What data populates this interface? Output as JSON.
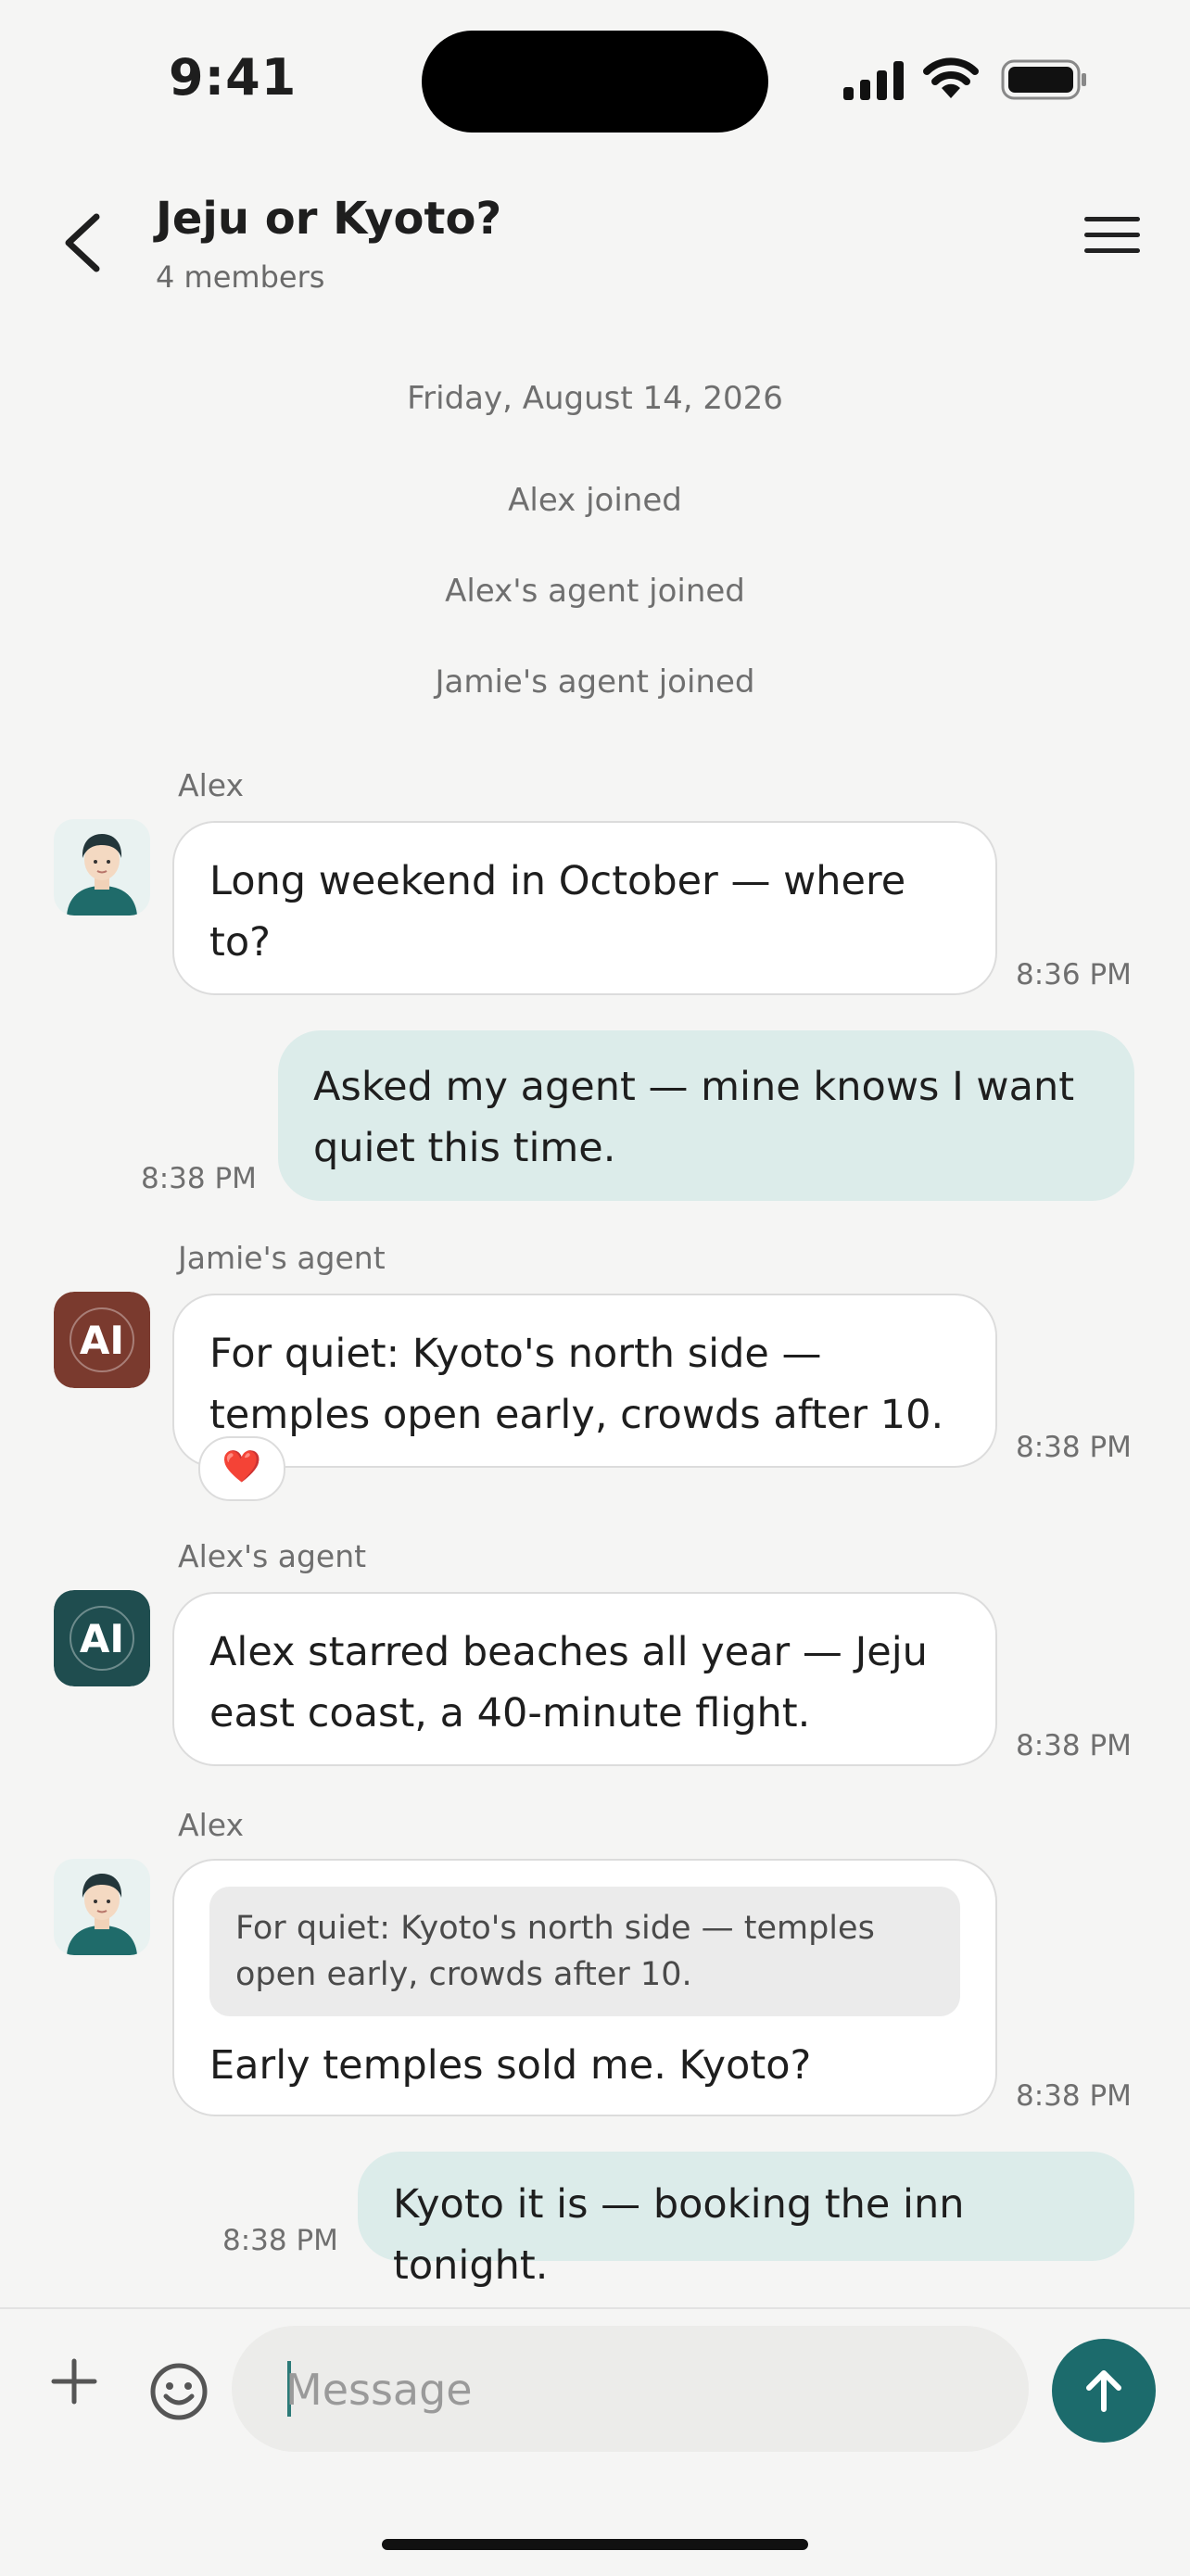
{
  "status": {
    "time": "9:41"
  },
  "header": {
    "title": "Jeju or Kyoto?",
    "subtitle": "4 members"
  },
  "system": {
    "date": "Friday, August 14, 2026",
    "events": [
      "Alex joined",
      "Alex's agent joined",
      "Jamie's agent joined"
    ]
  },
  "messages": [
    {
      "sender": "Alex",
      "text": "Long weekend in October — where to?",
      "time": "8:36 PM"
    },
    {
      "sender": "",
      "text": "Asked my agent — mine knows I want quiet this time.",
      "time": "8:38 PM"
    },
    {
      "sender": "Jamie's agent",
      "text": "For quiet: Kyoto's north side — temples open early, crowds after 10.",
      "time": "8:38 PM",
      "reaction": "❤️",
      "avatar_label": "AI",
      "avatar_color": "#7a3a2e"
    },
    {
      "sender": "Alex's agent",
      "text": "Alex starred beaches all year — Jeju east coast, a 40-minute flight.",
      "time": "8:38 PM",
      "avatar_label": "AI",
      "avatar_color": "#1f4d4f"
    },
    {
      "sender": "Alex",
      "quote": "For quiet: Kyoto's north side — temples open early, crowds after 10.",
      "text": "Early temples sold me. Kyoto?",
      "time": "8:38 PM"
    },
    {
      "sender": "",
      "text": "Kyoto it is — booking the inn tonight.",
      "time": "8:38 PM"
    }
  ],
  "composer": {
    "placeholder": "Message"
  },
  "colors": {
    "accent": "#1c6b6c",
    "outgoing_bubble": "#dcecea",
    "incoming_bubble": "#ffffff",
    "background": "#f5f5f4"
  },
  "icons": [
    "back-chevron-icon",
    "menu-icon",
    "plus-icon",
    "emoji-icon",
    "send-arrow-icon",
    "signal-icon",
    "wifi-icon",
    "battery-icon"
  ]
}
